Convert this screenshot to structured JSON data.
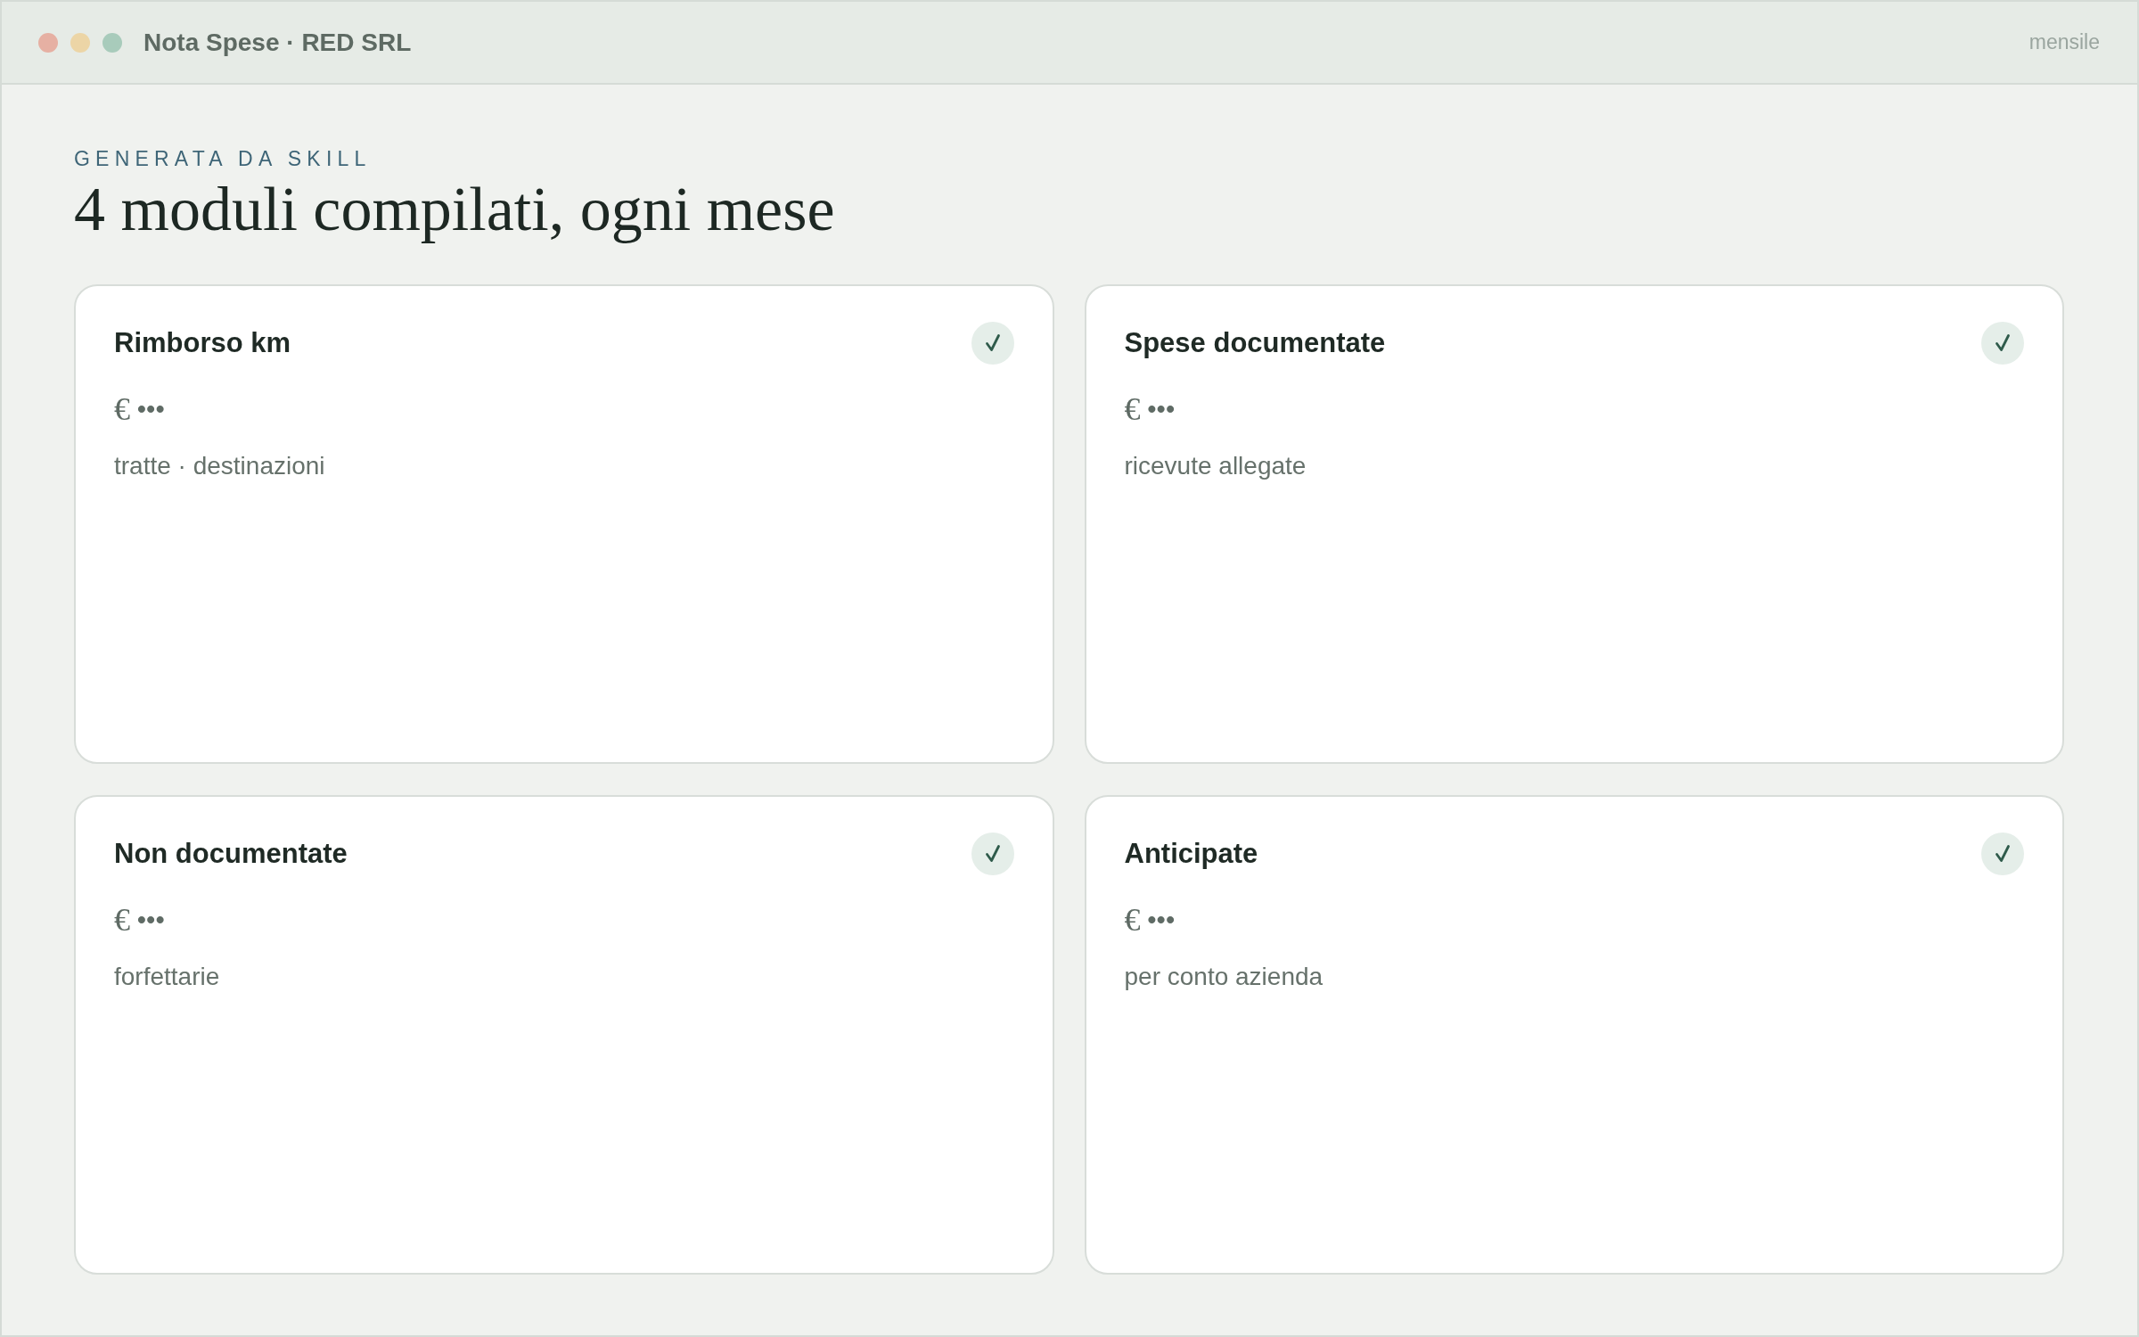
{
  "window": {
    "title": "Nota Spese · RED SRL",
    "period": "mensile"
  },
  "header": {
    "eyebrow": "GENERATA DA SKILL",
    "title": "4 moduli compilati, ogni mese"
  },
  "forms": [
    {
      "title": "Rimborso km",
      "currency": "€",
      "amount": "•••",
      "detail": "tratte · destinazioni",
      "done": true
    },
    {
      "title": "Spese documentate",
      "currency": "€",
      "amount": "•••",
      "detail": "ricevute allegate",
      "done": true
    },
    {
      "title": "Non documentate",
      "currency": "€",
      "amount": "•••",
      "detail": "forfettarie",
      "done": true
    },
    {
      "title": "Anticipate",
      "currency": "€",
      "amount": "•••",
      "detail": "per conto azienda",
      "done": true
    }
  ]
}
